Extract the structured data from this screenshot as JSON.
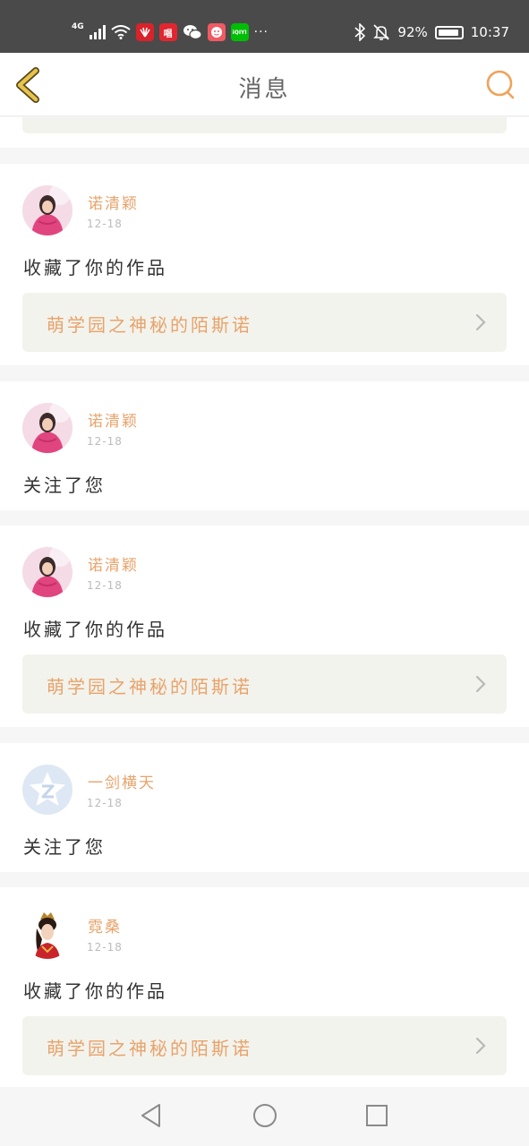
{
  "status_bar": {
    "network": "4G",
    "app_badges": [
      {
        "icon": "huawei-icon",
        "text": "",
        "color": "#d8232a"
      },
      {
        "icon": "chang-app-icon",
        "text": "唱",
        "color": "#e1262f"
      },
      {
        "icon": "wechat-icon",
        "text": "",
        "color": "#4a4a4a"
      },
      {
        "icon": "mascot-app-icon",
        "text": "",
        "color": "#f05a63"
      },
      {
        "icon": "iqiyi-icon",
        "text": "iQIYI",
        "color": "#00be06"
      }
    ],
    "more": "···",
    "battery_text": "92%",
    "battery_level": 0.92,
    "time": "10:37"
  },
  "header": {
    "title": "消息",
    "back_icon": "chevron-left-icon",
    "search_icon": "search-icon"
  },
  "messages": [
    {
      "user": "诺清颖",
      "date": "12-18",
      "action": "收藏了你的作品",
      "work_title": "萌学园之神秘的陌斯诺",
      "avatar": "girl-pink-avatar"
    },
    {
      "user": "诺清颖",
      "date": "12-18",
      "action": "关注了您",
      "avatar": "girl-pink-avatar"
    },
    {
      "user": "诺清颖",
      "date": "12-18",
      "action": "收藏了你的作品",
      "work_title": "萌学园之神秘的陌斯诺",
      "avatar": "girl-pink-avatar"
    },
    {
      "user": "一剑横天",
      "date": "12-18",
      "action": "关注了您",
      "avatar": "default-star-avatar"
    },
    {
      "user": "霓桑",
      "date": "12-18",
      "action": "收藏了你的作品",
      "work_title": "萌学园之神秘的陌斯诺",
      "avatar": "costume-lady-avatar"
    }
  ],
  "colors": {
    "accent": "#e8a36b",
    "back_icon": "#e6c34d",
    "work_card_bg": "#f3f3ed"
  },
  "nav_bar": {
    "back": "triangle-back-icon",
    "home": "circle-home-icon",
    "recents": "square-recents-icon"
  }
}
